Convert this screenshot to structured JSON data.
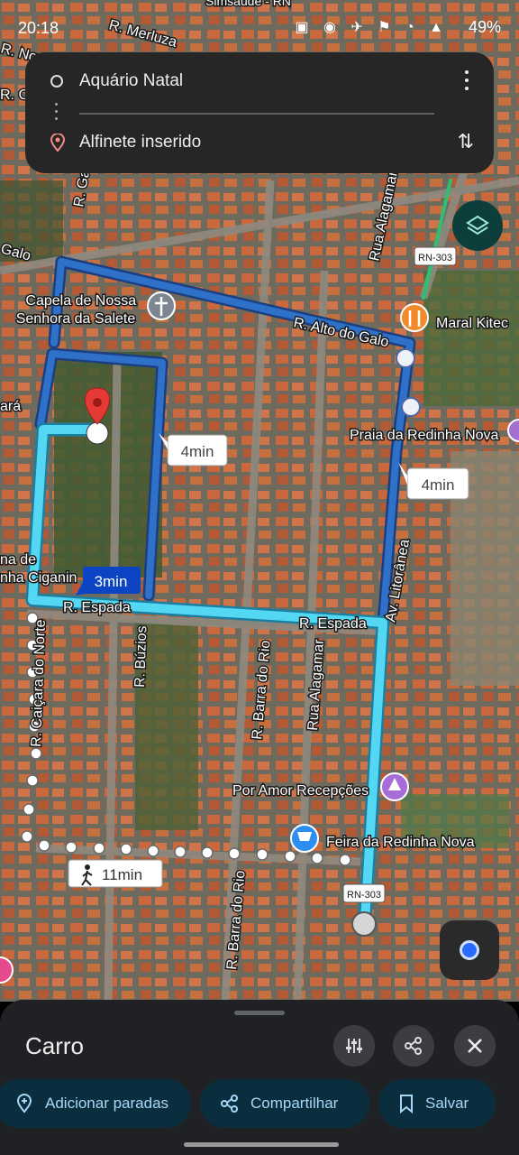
{
  "status_bar": {
    "time": "20:18",
    "battery": "49%"
  },
  "route": {
    "origin": "Aquário Natal",
    "destination": "Alfinete inserido"
  },
  "map": {
    "streets": [
      "R. Merluza",
      "R. Nova",
      "R. Ga",
      "Galo",
      "R. Alto do Galo",
      "Rua Alagamar",
      "R. Espada",
      "R. Espada",
      "R. Búzios",
      "R. Caiçara do Norte",
      "R. Barra do Rio",
      "Rua Alagamar",
      "Av. Litorânea",
      "R. Barra do Rio",
      "R. C",
      "ará",
      "na de",
      "nha Ciganin"
    ],
    "pois": {
      "church": "Capela de Nossa Senhora da Salete",
      "restaurant": "Maral Kitec",
      "beach": "Praia da Redinha Nova",
      "venue": "Por Amor Recepções",
      "market": "Feira da Redinha Nova",
      "top_text": "Simsaúde - RN"
    },
    "road_shields": [
      "RN-303",
      "RN-303"
    ],
    "route_labels": {
      "blue_alt": "4min",
      "right_alt": "4min",
      "selected": "3min",
      "walking": "11min"
    }
  },
  "sheet": {
    "mode_title": "Carro",
    "chips": {
      "add_stops": "Adicionar paradas",
      "share": "Compartilhar",
      "save": "Salvar"
    }
  },
  "colors": {
    "selected_route": "#54d7f2",
    "alt_route": "#1d5db4",
    "sheet_bg": "#202124",
    "chip_bg": "#0b2e3e",
    "chip_text": "#a8d7f5"
  }
}
